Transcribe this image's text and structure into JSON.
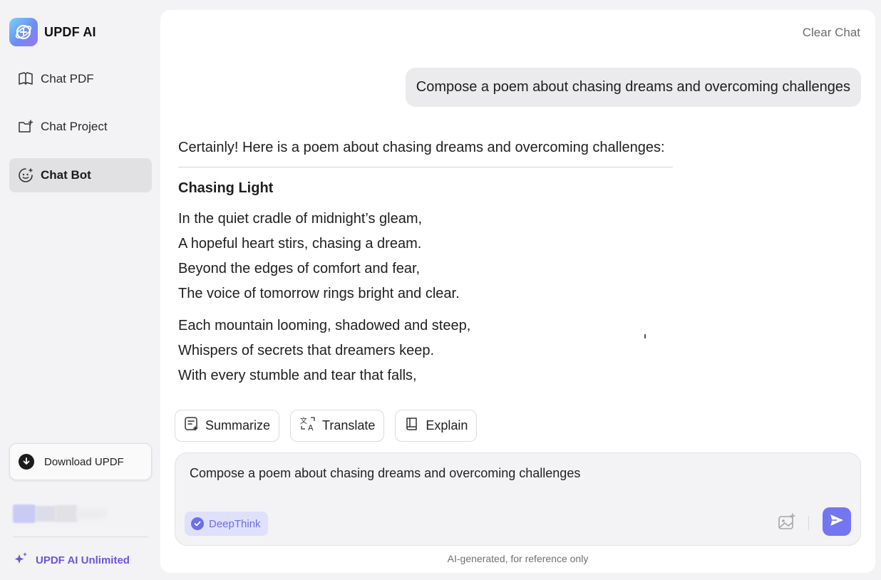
{
  "app": {
    "title": "UPDF AI"
  },
  "sidebar": {
    "items": [
      {
        "label": "Chat PDF",
        "icon": "book-icon"
      },
      {
        "label": "Chat Project",
        "icon": "folder-plus-icon"
      },
      {
        "label": "Chat Bot",
        "icon": "bot-face-icon",
        "active": true
      }
    ],
    "download_label": "Download UPDF",
    "unlimited_label": "UPDF AI Unlimited"
  },
  "header": {
    "clear_chat": "Clear Chat"
  },
  "conversation": {
    "user_message": "Compose a poem about chasing dreams and overcoming challenges",
    "answer_intro": "Certainly! Here is a poem about chasing dreams and overcoming challenges:",
    "poem_title": "Chasing Light",
    "stanza1": [
      "In the quiet cradle of midnight’s gleam,",
      "A hopeful heart stirs, chasing a dream.",
      "Beyond the edges of comfort and fear,",
      "The voice of tomorrow rings bright and clear."
    ],
    "stanza2": [
      "Each mountain looming, shadowed and steep,",
      "Whispers of secrets that dreamers keep.",
      "With every stumble and tear that falls,"
    ]
  },
  "actions": {
    "summarize": "Summarize",
    "translate": "Translate",
    "explain": "Explain"
  },
  "composer": {
    "text": "Compose a poem about chasing dreams and overcoming challenges",
    "deepthink_label": "DeepThink",
    "deepthink_enabled": true
  },
  "footer": {
    "disclaimer": "AI-generated, for reference only"
  },
  "colors": {
    "accent": "#7376f0",
    "brand_purple": "#6b55e0",
    "active_nav_bg": "#e1e1e4"
  }
}
